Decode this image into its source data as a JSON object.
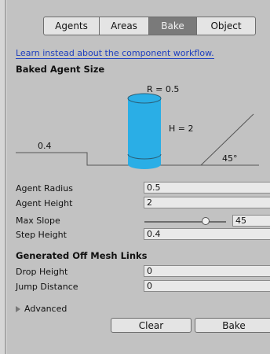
{
  "tabs": [
    "Agents",
    "Areas",
    "Bake",
    "Object"
  ],
  "active_tab": "Bake",
  "link_text": "Learn instead about the component workflow.",
  "baked_agent_size": {
    "header": "Baked Agent Size",
    "radius_label": "R = 0.5",
    "height_label": "H = 2",
    "step_label": "0.4",
    "slope_label": "45°"
  },
  "fields": {
    "agent_radius": {
      "label": "Agent Radius",
      "value": "0.5"
    },
    "agent_height": {
      "label": "Agent Height",
      "value": "2"
    },
    "max_slope": {
      "label": "Max Slope",
      "value": "45",
      "slider_fraction": 0.75
    },
    "step_height": {
      "label": "Step Height",
      "value": "0.4"
    }
  },
  "offmesh": {
    "header": "Generated Off Mesh Links",
    "drop_height": {
      "label": "Drop Height",
      "value": "0"
    },
    "jump_distance": {
      "label": "Jump Distance",
      "value": "0"
    }
  },
  "advanced_label": "Advanced",
  "buttons": {
    "clear": "Clear",
    "bake": "Bake"
  },
  "colors": {
    "cylinder": "#2aaee6",
    "link": "#1e3fbf"
  }
}
